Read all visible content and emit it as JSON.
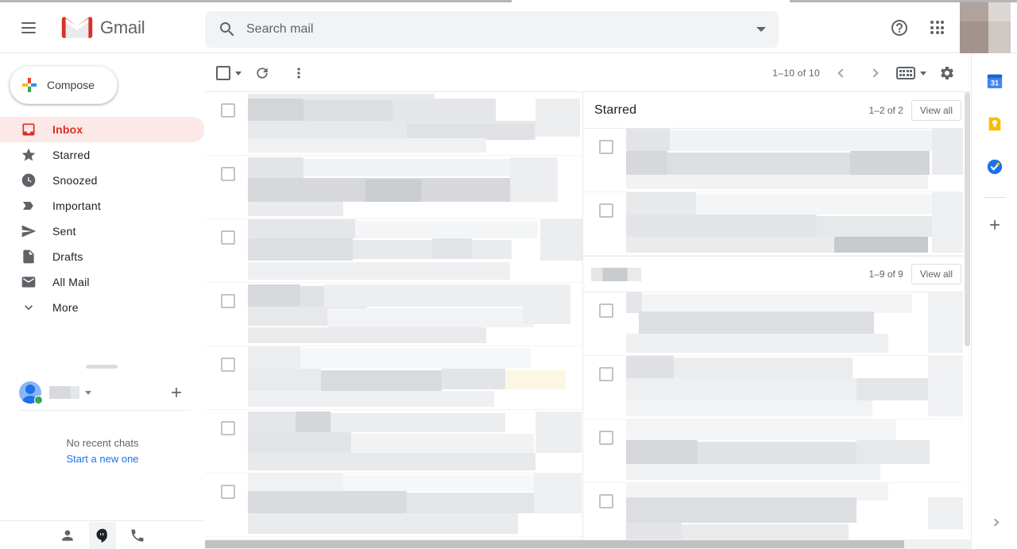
{
  "app": {
    "brand": "Gmail",
    "title": "Gmail"
  },
  "header": {
    "menu_icon": "hamburger-icon",
    "logo_icon": "gmail-logo-icon",
    "search": {
      "icon": "search-icon",
      "placeholder": "Search mail",
      "value": "",
      "options_icon": "chevron-down-icon"
    },
    "help_icon": "help-circle-icon",
    "apps_icon": "apps-grid-icon",
    "avatar_icon": "account-avatar"
  },
  "sidebar": {
    "compose": {
      "label": "Compose",
      "icon": "plus-icon"
    },
    "items": [
      {
        "label": "Inbox",
        "icon": "inbox-icon",
        "active": true
      },
      {
        "label": "Starred",
        "icon": "star-icon",
        "active": false
      },
      {
        "label": "Snoozed",
        "icon": "clock-icon",
        "active": false
      },
      {
        "label": "Important",
        "icon": "label-important-icon",
        "active": false
      },
      {
        "label": "Sent",
        "icon": "send-icon",
        "active": false
      },
      {
        "label": "Drafts",
        "icon": "draft-icon",
        "active": false
      },
      {
        "label": "All Mail",
        "icon": "mail-icon",
        "active": false
      },
      {
        "label": "More",
        "icon": "chevron-down-icon",
        "active": false
      }
    ],
    "chat": {
      "avatar_icon": "chat-avatar-icon",
      "status": "online",
      "name": "",
      "menu_icon": "chevron-down-icon",
      "add_icon": "plus-icon",
      "empty_title": "No recent chats",
      "empty_link": "Start a new one",
      "footer_icons": [
        "contacts-icon",
        "hangouts-icon",
        "phone-icon"
      ],
      "footer_selected": 1
    }
  },
  "toolbar": {
    "select_all": {
      "icon": "checkbox-icon",
      "caret_icon": "chevron-down-icon"
    },
    "refresh_icon": "refresh-icon",
    "more_icon": "more-vertical-icon",
    "page_count": "1–10 of 10",
    "prev_icon": "chevron-left-icon",
    "next_icon": "chevron-right-icon",
    "input_tools_icon": "keyboard-icon",
    "input_tools_caret": "chevron-down-icon",
    "settings_icon": "gear-icon"
  },
  "mail_list": {
    "rows": [
      {
        "checkbox": "unchecked"
      },
      {
        "checkbox": "unchecked"
      },
      {
        "checkbox": "unchecked"
      },
      {
        "checkbox": "unchecked"
      },
      {
        "checkbox": "unchecked"
      },
      {
        "checkbox": "unchecked"
      },
      {
        "checkbox": "unchecked"
      }
    ]
  },
  "right_pane": {
    "sections": [
      {
        "title": "Starred",
        "title_redacted": false,
        "count": "1–2 of 2",
        "view_all": "View all",
        "rows": [
          {
            "checkbox": "unchecked"
          },
          {
            "checkbox": "unchecked"
          }
        ]
      },
      {
        "title": "",
        "title_redacted": true,
        "count": "1–9 of 9",
        "view_all": "View all",
        "rows": [
          {
            "checkbox": "unchecked"
          },
          {
            "checkbox": "unchecked"
          },
          {
            "checkbox": "unchecked"
          },
          {
            "checkbox": "unchecked"
          }
        ]
      }
    ]
  },
  "rail": {
    "items": [
      {
        "icon": "google-calendar-icon",
        "label": "Calendar",
        "day": "31"
      },
      {
        "icon": "google-keep-icon",
        "label": "Keep"
      },
      {
        "icon": "google-tasks-icon",
        "label": "Tasks"
      }
    ],
    "add_icon": "plus-icon",
    "expand_icon": "chevron-right-icon"
  },
  "colors": {
    "brand_red": "#d93025",
    "accent_blue": "#1a73e8",
    "inbox_active_bg": "#fce8e6",
    "toolbar_grey": "#5f6368",
    "divider": "#e8eaed",
    "calendar_blue": "#4285f4",
    "keep_yellow": "#fbbc04",
    "tasks_blue": "#1a73e8",
    "online_green": "#34a853"
  }
}
